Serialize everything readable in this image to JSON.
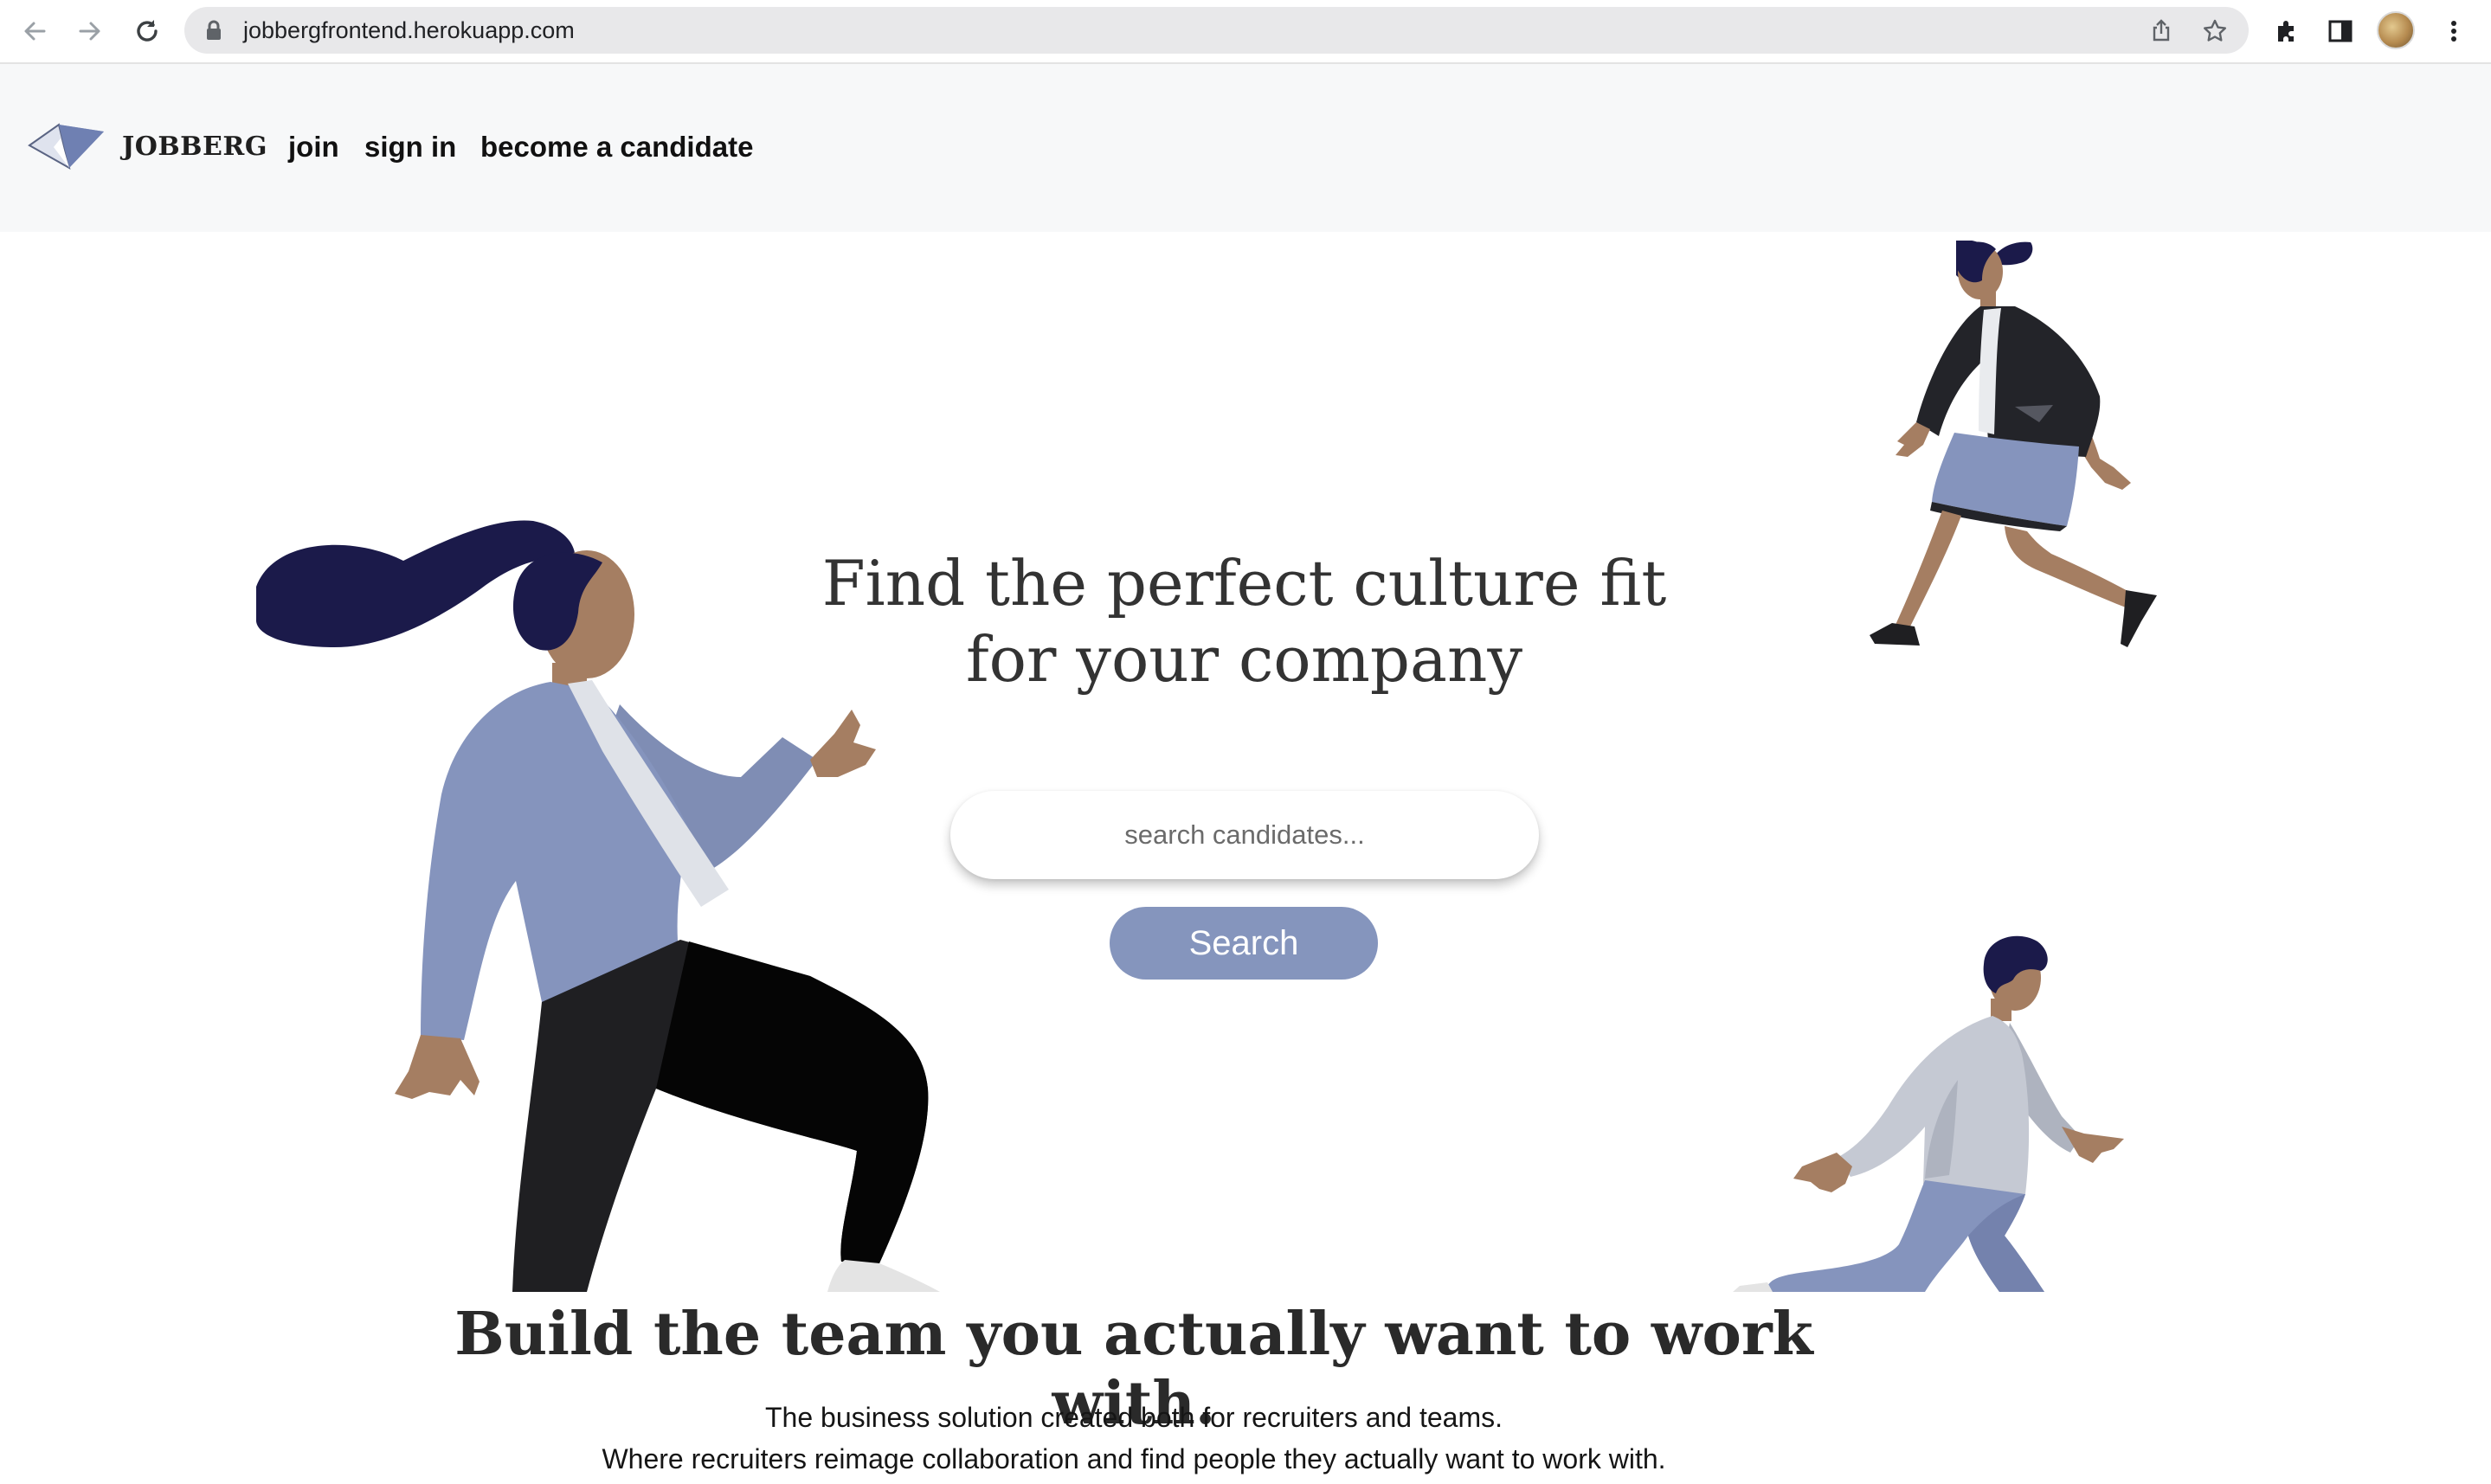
{
  "browser": {
    "url": "jobbergfrontend.herokuapp.com",
    "icons": [
      "back-icon",
      "forward-icon",
      "reload-icon",
      "lock-icon",
      "share-icon",
      "bookmark-star-icon",
      "extensions-icon",
      "side-panel-icon",
      "profile-avatar",
      "more-menu-icon"
    ]
  },
  "header": {
    "brand": "JOBBERG",
    "nav": [
      {
        "label": "join"
      },
      {
        "label": "sign in"
      },
      {
        "label": "become a candidate"
      }
    ]
  },
  "hero": {
    "title_line1": "Find the perfect culture fit",
    "title_line2": "for your company",
    "search_placeholder": "search candidates...",
    "search_button": "Search"
  },
  "section": {
    "title": "Build the team you actually want to work with.",
    "line1": "The business solution created both for recruiters and teams.",
    "line2": "Where recruiters reimage collaboration and find people they actually want to work with."
  },
  "colors": {
    "accent": "#8595bd",
    "header_bg": "#f7f8f9",
    "hair": "#1b1a4a",
    "skin": "#a57e62",
    "jacket_blue": "#8594bd",
    "dark": "#1f1f22"
  }
}
